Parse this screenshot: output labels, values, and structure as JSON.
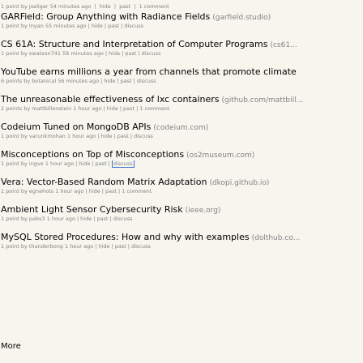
{
  "top_partial": {
    "sub": {
      "points": "1 point by jseliger",
      "age": "54 minutes ago",
      "hide": "hide",
      "past": "past",
      "comments": "1 comment"
    }
  },
  "stories": [
    {
      "title": "GARField: Group Anything with Radiance Fields",
      "site": "(garfield.studio)",
      "points": "1 point by lnyan",
      "age": "55 minutes ago",
      "hide": "hide",
      "past": "past",
      "comments": "discuss"
    },
    {
      "title": "CS 61A: Structure and Interpretation of Computer Programs",
      "site": "(cs61...",
      "points": "1 point by swatson741",
      "age": "56 minutes ago",
      "hide": "hide",
      "past": "past",
      "comments": "discuss"
    },
    {
      "title": "YouTube earns millions a year from channels that promote climate",
      "site": "",
      "points": "6 points by botanical",
      "age": "56 minutes ago",
      "hide": "hide",
      "past": "past",
      "comments": "discuss"
    },
    {
      "title": "The unreasonable effectiveness of lxc containers",
      "site": "(github.com/mattbill...",
      "points": "2 points by mattbillenstein",
      "age": "1 hour ago",
      "hide": "hide",
      "past": "past",
      "comments": "1 comment"
    },
    {
      "title": "Codeium Tuned on MongoDB APIs",
      "site": "(codeium.com)",
      "points": "1 point by varunkmohan",
      "age": "1 hour ago",
      "hide": "hide",
      "past": "past",
      "comments": "discuss"
    },
    {
      "title": "Misconceptions on Top of Misconceptions",
      "site": "(os2museum.com)",
      "points": "1 point by ingve",
      "age": "1 hour ago",
      "hide": "hide",
      "past": "past",
      "comments": "discuss",
      "comments_highlighted": true
    },
    {
      "title": "Vera: Vector-Based Random Matrix Adaptation",
      "site": "(dkopi.github.io)",
      "points": "1 point by egnehots",
      "age": "1 hour ago",
      "hide": "hide",
      "past": "past",
      "comments": "1 comment"
    },
    {
      "title": "Ambient Light Sensor Cybersecurity Risk",
      "site": "(ieee.org)",
      "points": "1 point by pabs3",
      "age": "1 hour ago",
      "hide": "hide",
      "past": "past",
      "comments": "discuss"
    },
    {
      "title": "MySQL Stored Procedures: How and why with examples",
      "site": "(dolthub.co...",
      "points": "1 point by thunderbong",
      "age": "1 hour ago",
      "hide": "hide",
      "past": "past",
      "comments": "discuss"
    }
  ],
  "more_label": "More",
  "colors": {
    "background": "#f6f6ef",
    "subtext": "#828282",
    "highlight": "#3a6fd0"
  }
}
